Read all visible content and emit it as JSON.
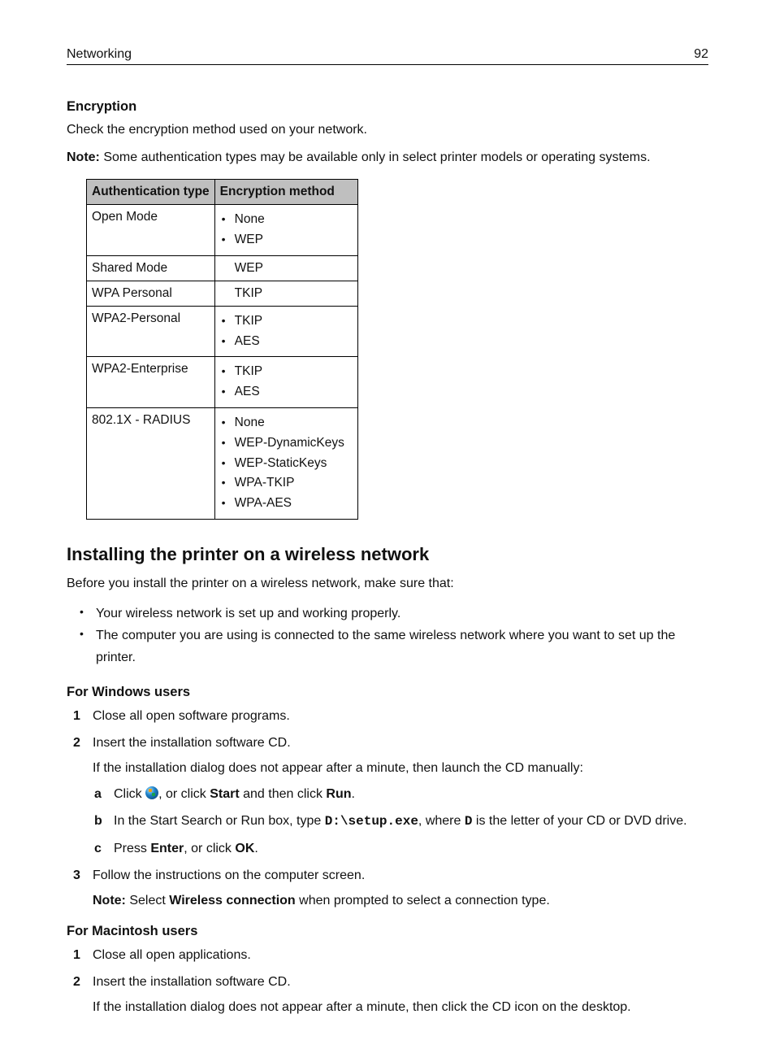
{
  "header": {
    "section": "Networking",
    "page_number": "92"
  },
  "encryption": {
    "heading": "Encryption",
    "intro": "Check the encryption method used on your network.",
    "note_label": "Note:",
    "note_text": " Some authentication types may be available only in select printer models or operating systems.",
    "columns": {
      "auth": "Authentication type",
      "method": "Encryption method"
    },
    "rows": {
      "r0": {
        "auth": "Open Mode",
        "methods": [
          "None",
          "WEP"
        ]
      },
      "r1": {
        "auth": "Shared Mode",
        "methods": [
          "WEP"
        ]
      },
      "r2": {
        "auth": "WPA Personal",
        "methods": [
          "TKIP"
        ]
      },
      "r3": {
        "auth": "WPA2-Personal",
        "methods": [
          "TKIP",
          "AES"
        ]
      },
      "r4": {
        "auth": "WPA2-Enterprise",
        "methods": [
          "TKIP",
          "AES"
        ]
      },
      "r5": {
        "auth": "802.1X - RADIUS",
        "methods": [
          "None",
          "WEP-DynamicKeys",
          "WEP-StaticKeys",
          "WPA-TKIP",
          "WPA-AES"
        ]
      }
    }
  },
  "install": {
    "heading": "Installing the printer on a wireless network",
    "intro": "Before you install the printer on a wireless network, make sure that:",
    "bullets": [
      "Your wireless network is set up and working properly.",
      "The computer you are using is connected to the same wireless network where you want to set up the printer."
    ]
  },
  "windows": {
    "heading": "For Windows users",
    "steps": {
      "s1": "Close all open software programs.",
      "s2": "Insert the installation software CD.",
      "s2b": "If the installation dialog does not appear after a minute, then launch the CD manually:",
      "sub": {
        "a_pre": "Click ",
        "a_mid": ", or click ",
        "a_start": "Start",
        "a_and": " and then click ",
        "a_run": "Run",
        "a_end": ".",
        "b_pre": "In the Start Search or Run box, type ",
        "b_code": "D:\\setup.exe",
        "b_mid": ", where ",
        "b_code2": "D",
        "b_end": " is the letter of your CD or DVD drive.",
        "c_pre": "Press ",
        "c_enter": "Enter",
        "c_mid": ", or click ",
        "c_ok": "OK",
        "c_end": "."
      },
      "s3": "Follow the instructions on the computer screen.",
      "note_label": "Note:",
      "note_pre": " Select ",
      "note_bold": "Wireless connection",
      "note_post": " when prompted to select a connection type."
    }
  },
  "mac": {
    "heading": "For Macintosh users",
    "steps": {
      "s1": "Close all open applications.",
      "s2": "Insert the installation software CD.",
      "s2b": "If the installation dialog does not appear after a minute, then click the CD icon on the desktop."
    }
  }
}
